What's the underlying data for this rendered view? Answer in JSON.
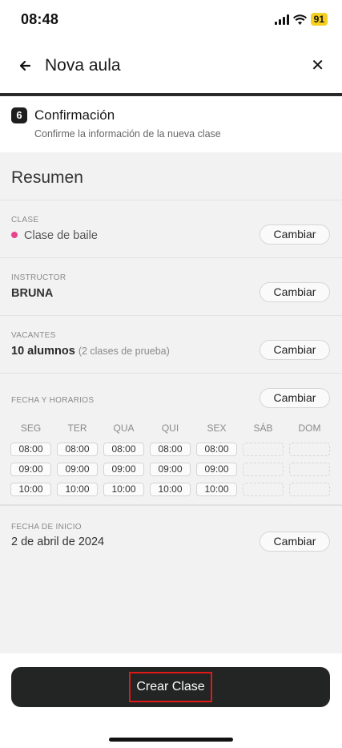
{
  "status": {
    "time": "08:48",
    "battery": "91"
  },
  "header": {
    "title": "Nova aula"
  },
  "step": {
    "number": "6",
    "title": "Confirmación",
    "subtitle": "Confirme la información de la nueva clase"
  },
  "summary": {
    "title": "Resumen",
    "change_label": "Cambiar",
    "clase": {
      "label": "CLASE",
      "value": "Clase de baile",
      "dot_color": "#e8458f"
    },
    "instructor": {
      "label": "INSTRUCTOR",
      "value": "BRUNA"
    },
    "vacantes": {
      "label": "VACANTES",
      "value": "10 alumnos",
      "note": "(2 clases de prueba)"
    },
    "horarios": {
      "label": "FECHA Y HORARIOS",
      "days": [
        "SEG",
        "TER",
        "QUA",
        "QUI",
        "SEX",
        "SÁB",
        "DOM"
      ],
      "times": [
        [
          "08:00",
          "08:00",
          "08:00",
          "08:00",
          "08:00",
          "",
          ""
        ],
        [
          "09:00",
          "09:00",
          "09:00",
          "09:00",
          "09:00",
          "",
          ""
        ],
        [
          "10:00",
          "10:00",
          "10:00",
          "10:00",
          "10:00",
          "",
          ""
        ]
      ]
    },
    "inicio": {
      "label": "FECHA DE INICIO",
      "value": "2 de abril de 2024"
    }
  },
  "footer": {
    "create_label": "Crear Clase"
  }
}
